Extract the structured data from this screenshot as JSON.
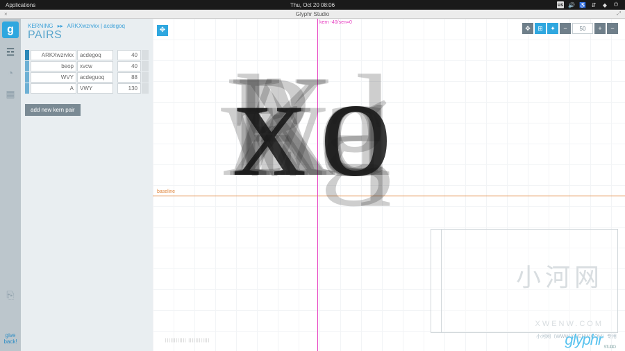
{
  "gnome": {
    "apps": "Applications",
    "clock": "Thu, Oct 20   08:06",
    "kb": "us"
  },
  "window": {
    "title": "Glyphr Studio"
  },
  "breadcrumb": {
    "section": "KERNING",
    "pair": "ARKXwzrvkx | acdegoq"
  },
  "page": {
    "title": "PAIRS"
  },
  "kern_rows": [
    {
      "left": "ARKXwzrvkx",
      "right": "acdegoq",
      "value": "40"
    },
    {
      "left": "beop",
      "right": "xvcw",
      "value": "40"
    },
    {
      "left": "WVY",
      "right": "acdeguoq",
      "value": "88"
    },
    {
      "left": "A",
      "right": "VWY",
      "value": "130"
    }
  ],
  "buttons": {
    "add_pair": "add new kern pair"
  },
  "rail": {
    "give_back": "give\nback!"
  },
  "canvas": {
    "baseline_label": "baseline",
    "kern_label": "kern -40/sen=0",
    "zoom": "50",
    "left_glyphs": [
      "A",
      "R",
      "K",
      "X",
      "w",
      "z",
      "r",
      "v",
      "k",
      "x"
    ],
    "right_glyphs": [
      "a",
      "c",
      "d",
      "e",
      "g",
      "o",
      "q"
    ]
  },
  "watermark": {
    "big": "小河网",
    "url": "XWENW.COM",
    "caption": "小河网（WWW.XWENW.COM）专用"
  },
  "brand": "glyphr"
}
